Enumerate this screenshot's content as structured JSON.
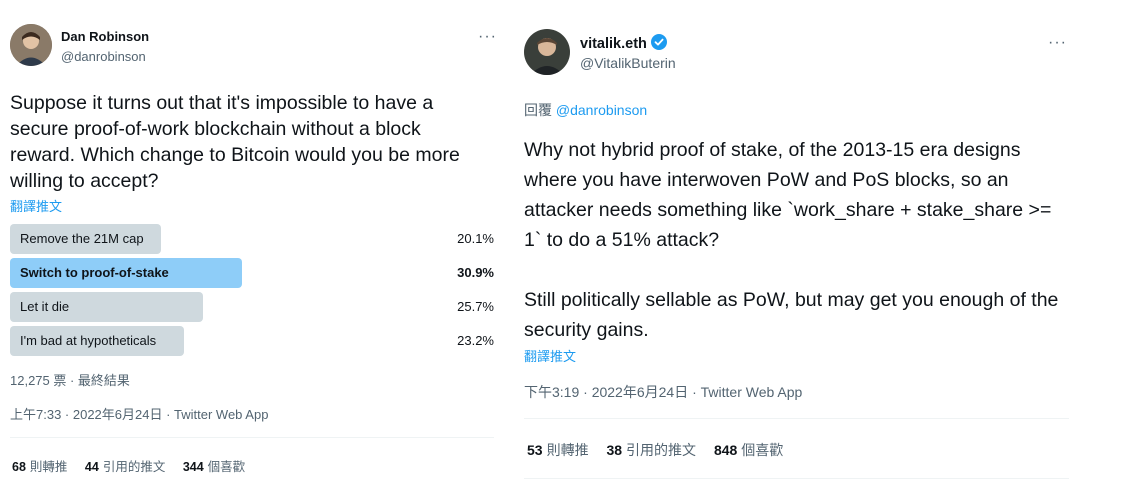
{
  "left_tweet": {
    "author": {
      "name": "Dan Robinson",
      "handle": "@danrobinson"
    },
    "text": "Suppose it turns out that it's impossible to have a secure proof-of-work blockchain without a block reward. Which change to Bitcoin would you be more willing to accept?",
    "translate_label": "翻譯推文",
    "poll": {
      "options": [
        {
          "label": "Remove the 21M cap",
          "percent": "20.1%",
          "fraction": 0.201,
          "winner": false
        },
        {
          "label": "Switch to proof-of-stake",
          "percent": "30.9%",
          "fraction": 0.309,
          "winner": true
        },
        {
          "label": "Let it die",
          "percent": "25.7%",
          "fraction": 0.257,
          "winner": false
        },
        {
          "label": "I'm bad at hypotheticals",
          "percent": "23.2%",
          "fraction": 0.232,
          "winner": false
        }
      ],
      "summary": "12,275 票 · 最終結果"
    },
    "timestamp": "上午7:33 · 2022年6月24日 · Twitter Web App",
    "stats": {
      "retweets_count": "68",
      "retweets_label": "則轉推",
      "quotes_count": "44",
      "quotes_label": "引用的推文",
      "likes_count": "344",
      "likes_label": "個喜歡"
    },
    "more_icon": "more-horizontal-icon"
  },
  "right_tweet": {
    "author": {
      "name": "vitalik.eth",
      "handle": "@VitalikButerin",
      "verified": true
    },
    "reply_prefix": "回覆",
    "reply_to": "@danrobinson",
    "text_p1": "Why not hybrid proof of stake, of the 2013-15 era designs where you have interwoven PoW and PoS blocks, so an attacker needs something like `work_share + stake_share >= 1` to do a 51% attack?",
    "text_p2": "Still politically sellable as PoW, but may get you enough of the security gains.",
    "translate_label": "翻譯推文",
    "timestamp": "下午3:19 · 2022年6月24日 · Twitter Web App",
    "stats": {
      "retweets_count": "53",
      "retweets_label": "則轉推",
      "quotes_count": "38",
      "quotes_label": "引用的推文",
      "likes_count": "848",
      "likes_label": "個喜歡"
    },
    "more_icon": "more-horizontal-icon"
  },
  "colors": {
    "accent": "#1d9bf0",
    "poll_bar": "#cfd9de",
    "poll_winner": "#8ecdf8",
    "secondary_text": "#536471"
  }
}
